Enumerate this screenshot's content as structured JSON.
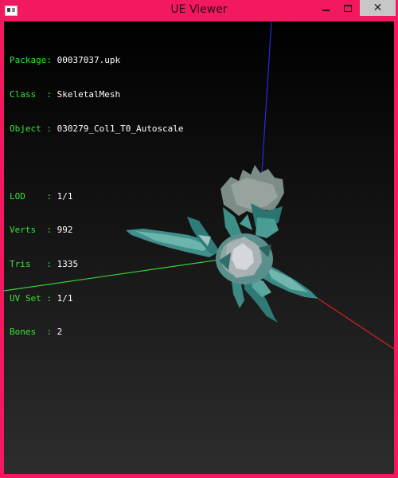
{
  "window": {
    "title": "UE Viewer",
    "controls": {
      "minimize": "minimize",
      "maximize": "maximize",
      "close": "✕"
    }
  },
  "info": {
    "group1": [
      {
        "key": "Package",
        "value": "00037037.upk"
      },
      {
        "key": "Class  ",
        "value": "SkeletalMesh"
      },
      {
        "key": "Object ",
        "value": "030279_Col1_T0_Autoscale"
      }
    ],
    "group2": [
      {
        "key": "LOD    ",
        "value": "1/1"
      },
      {
        "key": "Verts  ",
        "value": "992"
      },
      {
        "key": "Tris   ",
        "value": "1335"
      },
      {
        "key": "UV Set ",
        "value": "1/1"
      },
      {
        "key": "Bones  ",
        "value": "2"
      }
    ]
  },
  "colors": {
    "frame": "#f2195f",
    "axis_x": "#d42020",
    "axis_y": "#38d438",
    "axis_z": "#2a2adc",
    "label_key": "#37e337",
    "label_value": "#ffffff"
  }
}
